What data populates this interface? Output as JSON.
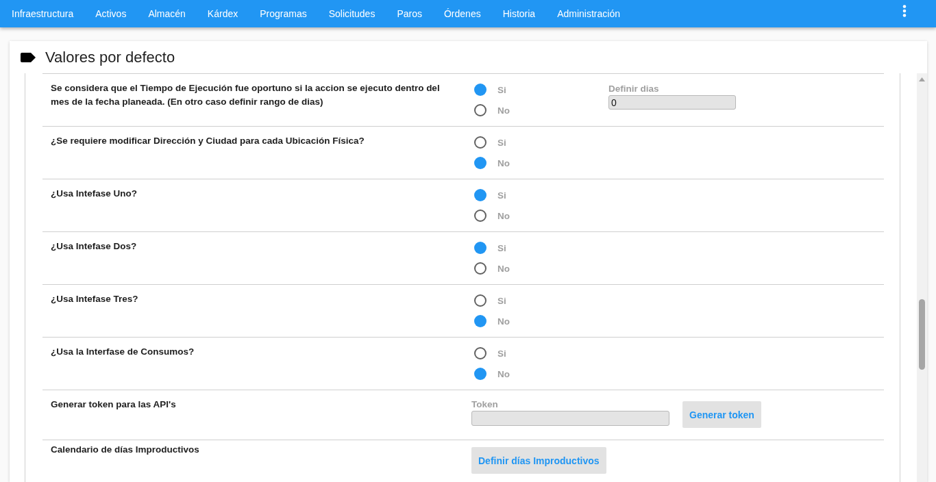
{
  "nav": {
    "items": [
      "Infraestructura",
      "Activos",
      "Almacén",
      "Kárdex",
      "Programas",
      "Solicitudes",
      "Paros",
      "Órdenes",
      "Historia",
      "Administración"
    ]
  },
  "card": {
    "title": "Valores por defecto"
  },
  "settings": [
    {
      "kind": "choice",
      "question": "Se considera que el Tiempo de Ejecución fue oportuno si la accion se ejecuto dentro del mes de la fecha planeada. (En otro caso definir rango de dias)",
      "options": [
        {
          "label": "Si",
          "selected": true
        },
        {
          "label": "No",
          "selected": false
        }
      ],
      "days_field": {
        "label": "Definir dias",
        "value": "0",
        "disabled": true
      }
    },
    {
      "kind": "choice",
      "question": "¿Se requiere modificar Dirección y Ciudad para cada Ubicación Física?",
      "options": [
        {
          "label": "Si",
          "selected": false
        },
        {
          "label": "No",
          "selected": true
        }
      ]
    },
    {
      "kind": "choice",
      "question": "¿Usa Intefase Uno?",
      "options": [
        {
          "label": "Si",
          "selected": true
        },
        {
          "label": "No",
          "selected": false
        }
      ]
    },
    {
      "kind": "choice",
      "question": "¿Usa Intefase Dos?",
      "options": [
        {
          "label": "Si",
          "selected": true
        },
        {
          "label": "No",
          "selected": false
        }
      ]
    },
    {
      "kind": "choice",
      "question": "¿Usa Intefase Tres?",
      "options": [
        {
          "label": "Si",
          "selected": false
        },
        {
          "label": "No",
          "selected": true
        }
      ]
    },
    {
      "kind": "choice",
      "question": "¿Usa la Interfase de Consumos?",
      "options": [
        {
          "label": "Si",
          "selected": false
        },
        {
          "label": "No",
          "selected": true
        }
      ]
    },
    {
      "kind": "token",
      "question": "Generar token para las API's",
      "token_field": {
        "label": "Token",
        "disabled": true
      },
      "button": "Generar token"
    },
    {
      "kind": "action",
      "question": "Calendario de días Improductivos",
      "button": "Definir días Improductivos"
    }
  ]
}
